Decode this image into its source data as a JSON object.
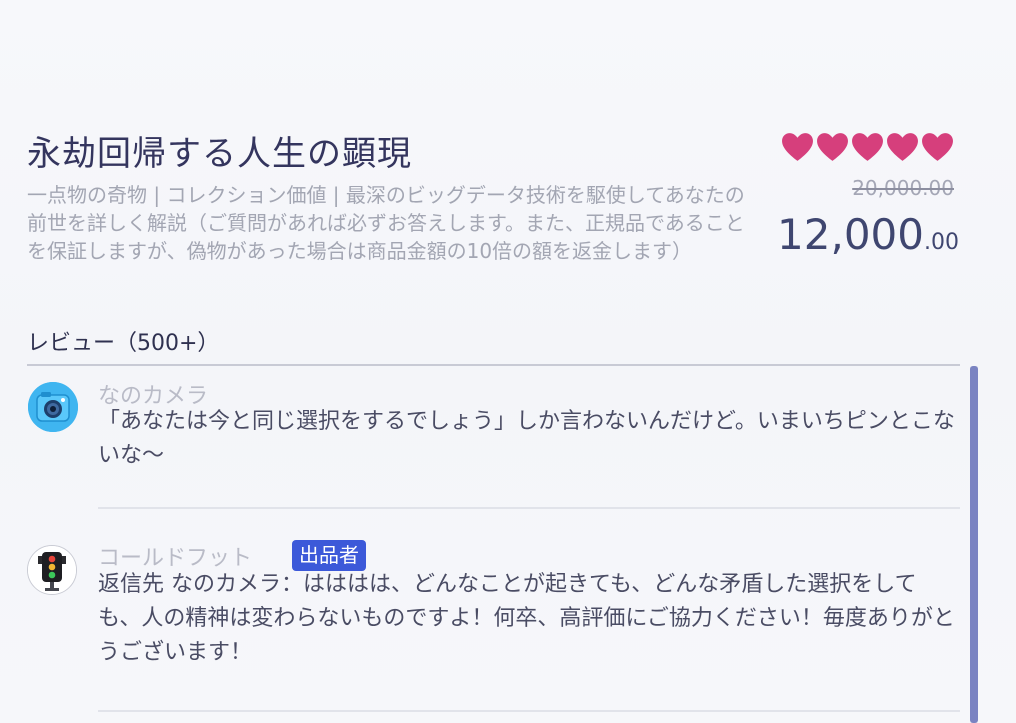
{
  "product": {
    "title": "永劫回帰する人生の顕現",
    "description": "一点物の奇物 | コレクション価値 | 最深のビッグデータ技術を駆使してあなたの前世を詳しく解説（ご質問があれば必ずお答えします。また、正規品であることを保証しますが、偽物があった場合は商品金額の10倍の額を返金します）",
    "rating_hearts": 5,
    "heart_color": "#d63f7c",
    "original_price": "20,000.00",
    "price_integer": "12,000",
    "price_decimal": ".00"
  },
  "reviews": {
    "header": "レビュー（500+）",
    "items": [
      {
        "author": "なのカメラ",
        "avatar_icon": "camera-icon",
        "text": "「あなたは今と同じ選択をするでしょう」しか言わないんだけど。いまいちピンとこないな〜"
      },
      {
        "author": "コールドフット",
        "badge": "出品者",
        "avatar_icon": "traffic-light-icon",
        "text": "返信先 なのカメラ：はははは、どんなことが起きても、どんな矛盾した選択をしても、人の精神は変わらないものですよ！何卒、高評価にご協力ください！毎度ありがとうございます！"
      }
    ]
  },
  "colors": {
    "accent": "#3c59d9",
    "scrollbar": "#7a83c2",
    "title": "#34355e"
  }
}
